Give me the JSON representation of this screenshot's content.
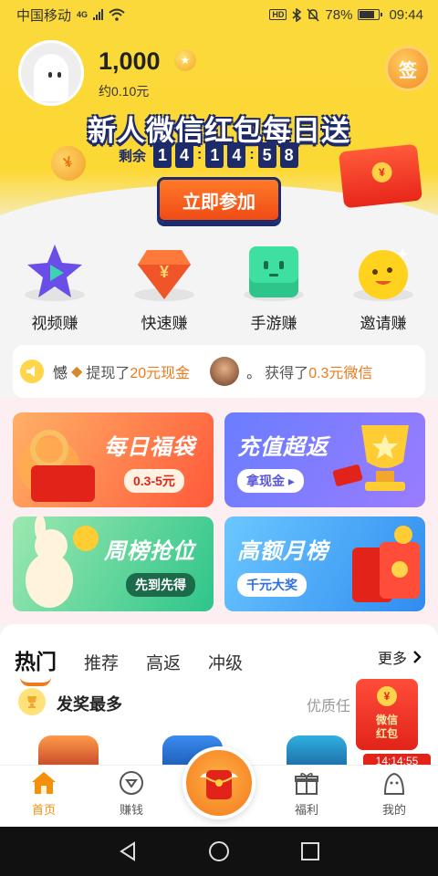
{
  "status_bar": {
    "carrier": "中国移动",
    "network": "4G",
    "battery_percent": "78%",
    "battery_level": 0.78,
    "time": "09:44",
    "hd_label": "HD"
  },
  "header": {
    "coins": "1,000",
    "approx_value": "约0.10元",
    "sign_label": "签",
    "promo_title": "新人微信红包每日送",
    "countdown_label": "剩余",
    "countdown_digits": [
      "1",
      "4",
      "1",
      "4",
      "5",
      "8"
    ],
    "join_button": "立即参加",
    "coin_symbol": "¥"
  },
  "categories": [
    {
      "label": "视频赚",
      "icon": "video-star-icon"
    },
    {
      "label": "快速赚",
      "icon": "diamond-yuan-icon"
    },
    {
      "label": "手游赚",
      "icon": "game-cube-icon"
    },
    {
      "label": "邀请赚",
      "icon": "smiley-icon"
    }
  ],
  "ticker": {
    "item1_user": "憾",
    "item1_action": "提现了",
    "item1_amount": "20元现金",
    "item2_user": "。",
    "item2_action": "获得了",
    "item2_amount": "0.3元微信"
  },
  "promos": [
    {
      "title": "每日福袋",
      "tag": "0.3-5元"
    },
    {
      "title": "充值超返",
      "tag": "拿现金 ▸"
    },
    {
      "title": "周榜抢位",
      "tag": "先到先得"
    },
    {
      "title": "高额月榜",
      "tag": "千元大奖"
    }
  ],
  "list": {
    "tabs": [
      "热门",
      "推荐",
      "高返",
      "冲级"
    ],
    "more_label": "更多",
    "section_title": "发奖最多",
    "section_sub": "优质任",
    "float_env_line1": "微信",
    "float_env_line2": "红包",
    "float_timer": "14:14:55"
  },
  "bottom_nav": [
    {
      "label": "首页",
      "icon": "home-icon"
    },
    {
      "label": "赚钱",
      "icon": "earn-icon"
    },
    {
      "label": "福利",
      "icon": "gift-icon"
    },
    {
      "label": "我的",
      "icon": "profile-icon"
    }
  ],
  "colors": {
    "brand_yellow": "#fbd93a",
    "accent_orange": "#f07a1a",
    "navy": "#1d2b6a"
  }
}
